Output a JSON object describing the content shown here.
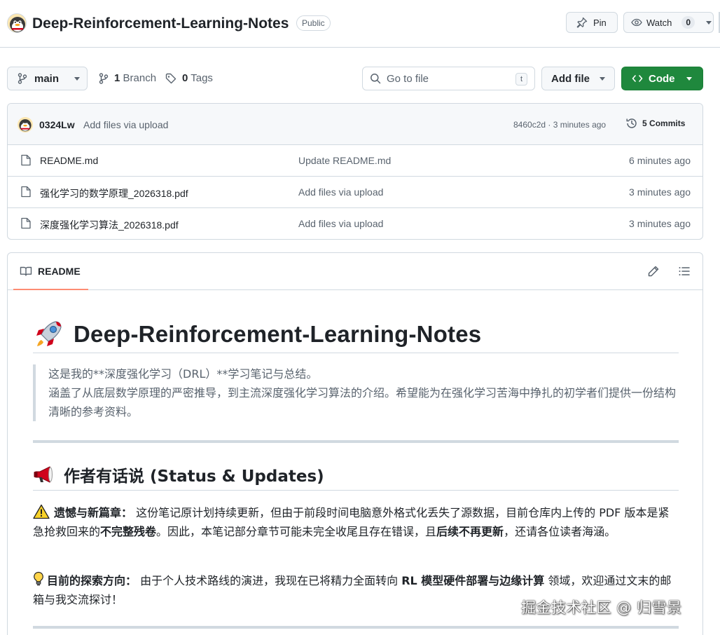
{
  "repo": {
    "name": "Deep-Reinforcement-Learning-Notes",
    "visibility": "Public",
    "pin_label": "Pin",
    "watch_label": "Watch",
    "watch_count": "0"
  },
  "nav": {
    "branch": "main",
    "branches_count": "1",
    "branches_label": "Branch",
    "tags_count": "0",
    "tags_label": "Tags",
    "goto_placeholder": "Go to file",
    "goto_shortcut": "t",
    "add_file_label": "Add file",
    "code_label": "Code",
    "code_color": "#1f883d"
  },
  "latest_commit": {
    "author": "0324Lw",
    "message": "Add files via upload",
    "meta": "8460c2d · 3 minutes ago",
    "commits_count": "5",
    "commits_label": "Commits"
  },
  "files": [
    {
      "name": "README.md",
      "commit": "Update README.md",
      "age": "6 minutes ago",
      "icon": "file-icon"
    },
    {
      "name": "强化学习的数学原理_2026318.pdf",
      "commit": "Add files via upload",
      "age": "3 minutes ago",
      "icon": "file-icon"
    },
    {
      "name": "深度强化学习算法_2026318.pdf",
      "commit": "Add files via upload",
      "age": "3 minutes ago",
      "icon": "file-icon"
    }
  ],
  "readme": {
    "tab_label": "README",
    "title": "Deep-Reinforcement-Learning-Notes",
    "title_icon": "rocket-icon",
    "quote_line1": "这是我的**深度强化学习（DRL）**学习笔记与总结。",
    "quote_line2": "涵盖了从底层数学原理的严密推导，到主流深度强化学习算法的介绍。希望能为在强化学习苦海中挣扎的初学者们提供一份结构清晰的参考资料。",
    "h2": "作者有话说 (Status & Updates)",
    "h2_icon": "megaphone-icon",
    "para1": {
      "label": "遗憾与新篇章：",
      "t1": "这份笔记原计划持续更新，但由于前段时间电脑意外格式化丢失了源数据，目前仓库内上传的 PDF 版本是紧急抢救回来的",
      "b1": "不完整残卷",
      "t2": "。因此，本笔记部分章节可能未完全收尾且存在错误，且",
      "b2": "后续不再更新",
      "t3": "，还请各位读者海涵。"
    },
    "para2": {
      "label": "目前的探索方向：",
      "t1": "由于个人技术路线的演进，我现在已将精力全面转向",
      "b1": "RL 模型硬件部署与边缘计算",
      "t2": "领域，欢迎通过文末的邮箱与我交流探讨！"
    }
  },
  "watermark": "掘金技术社区 @ 归雪景"
}
